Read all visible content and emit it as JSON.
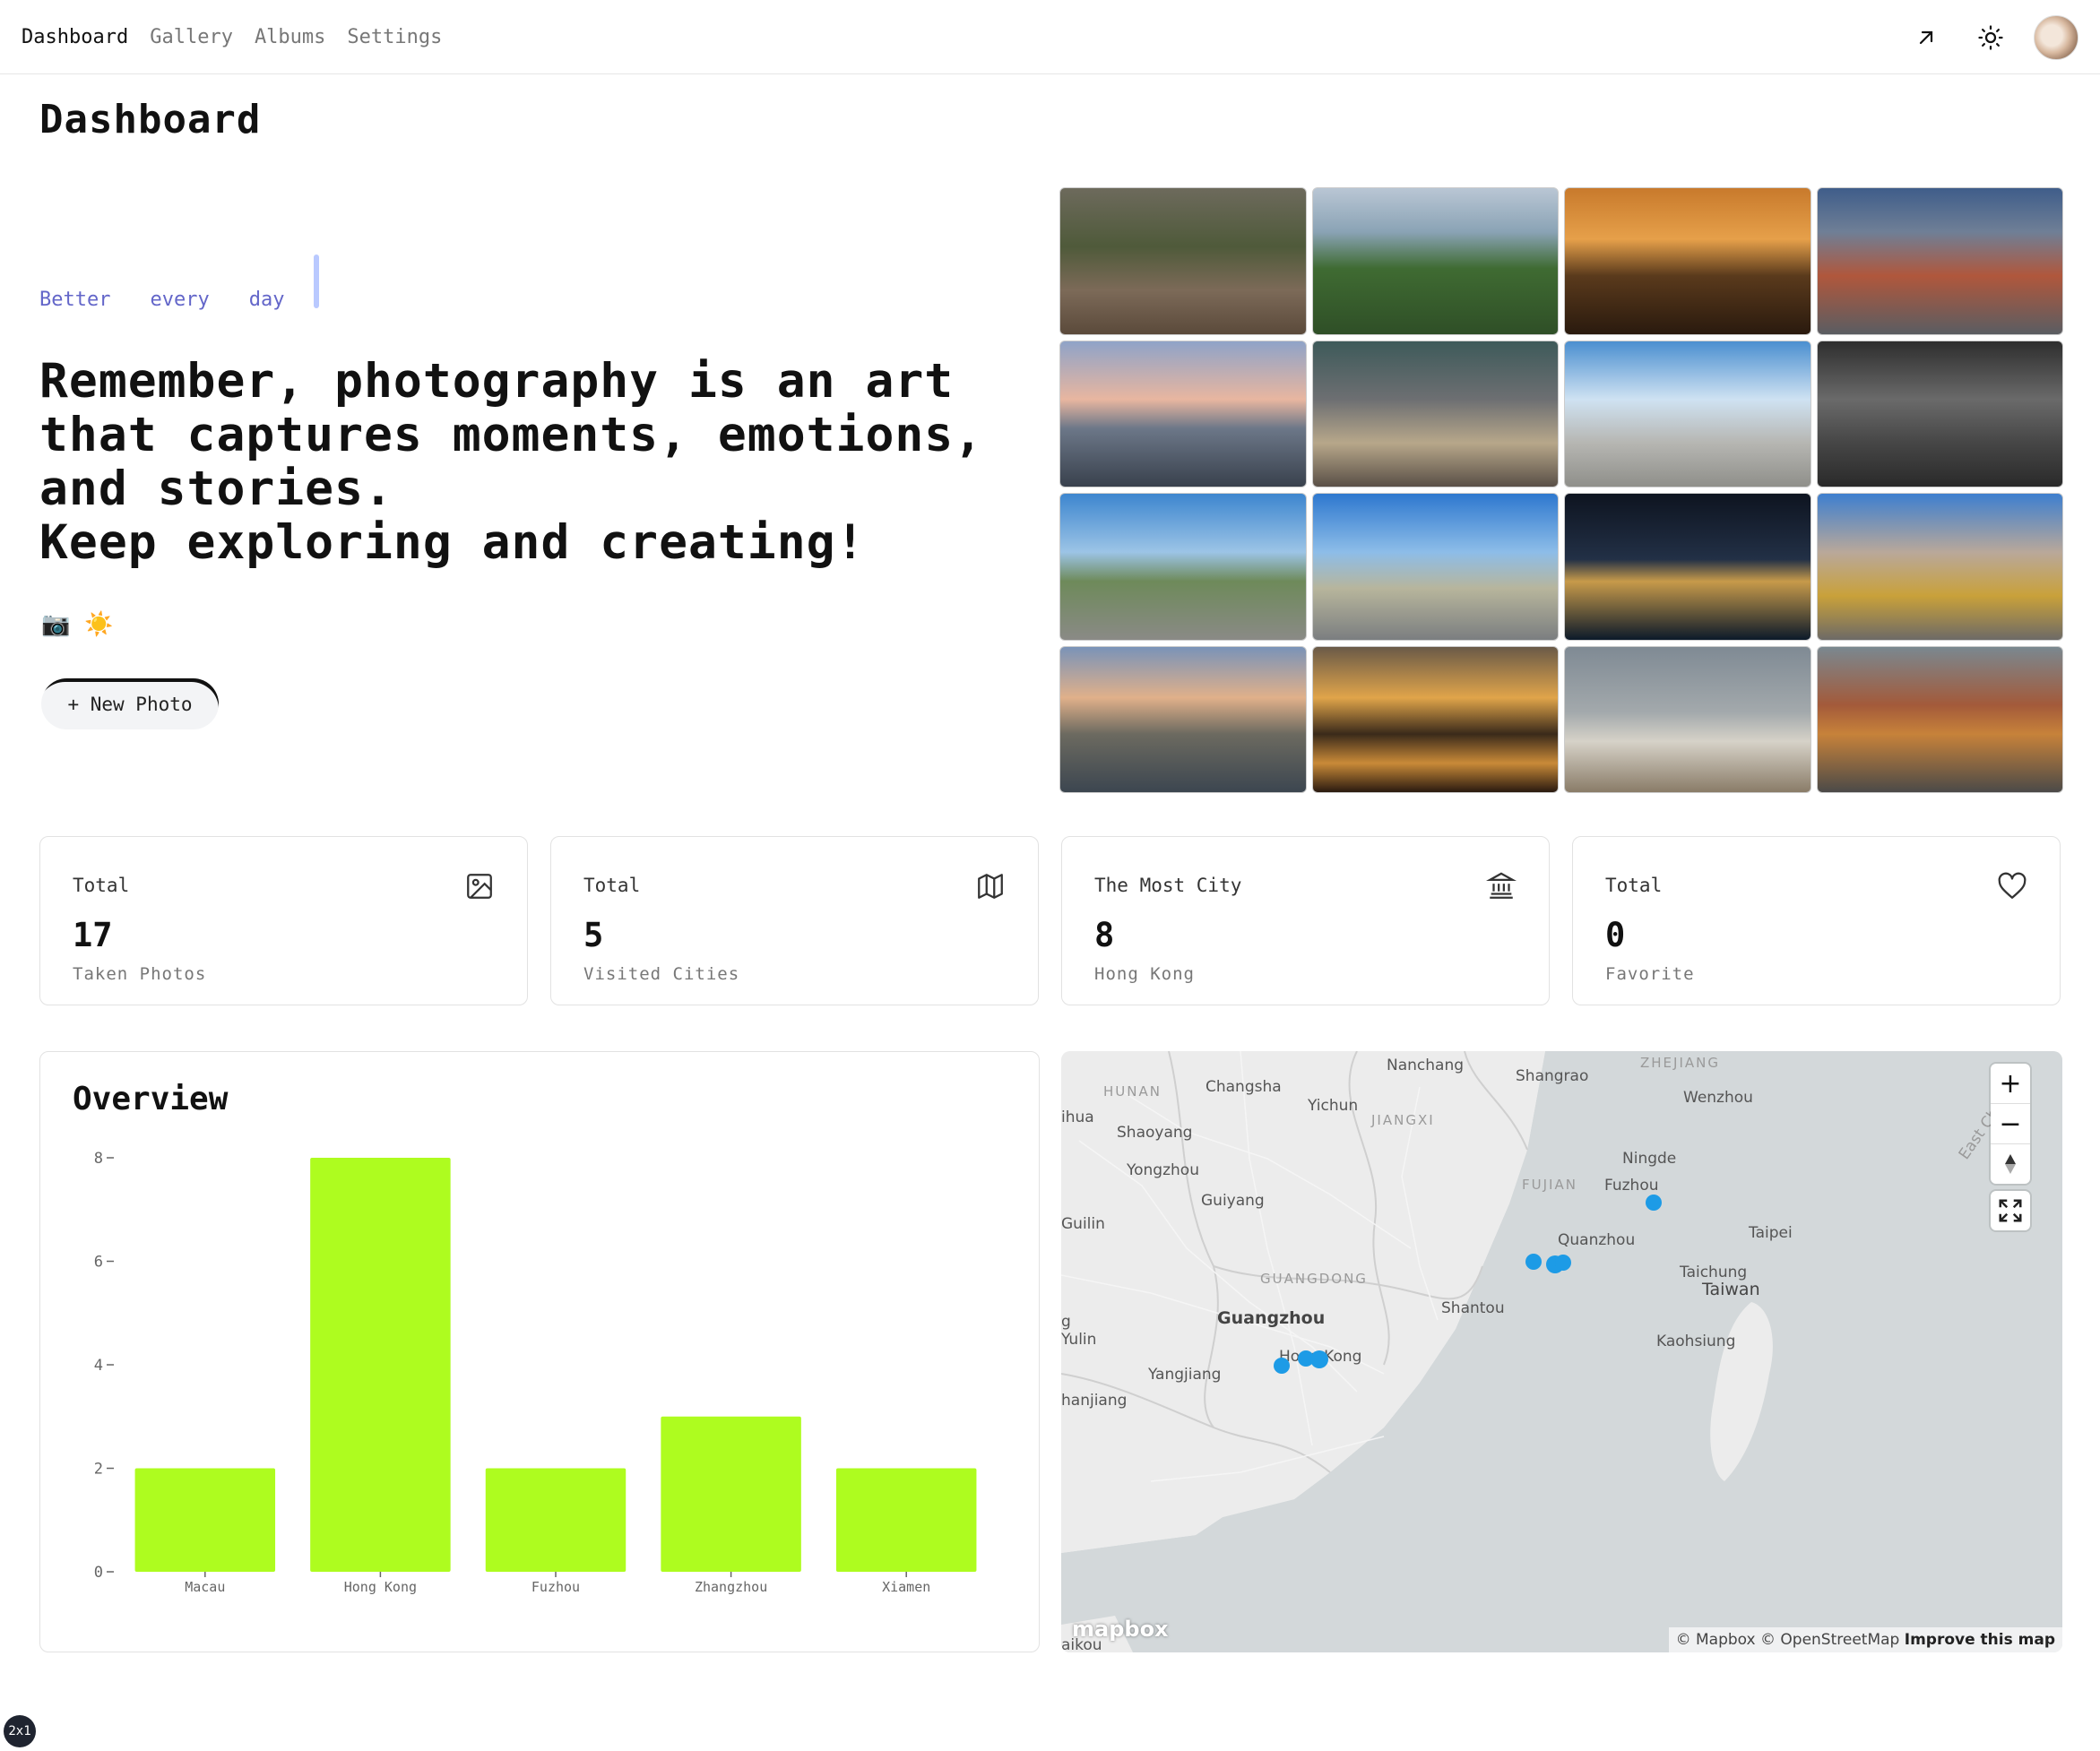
{
  "nav": {
    "links": [
      "Dashboard",
      "Gallery",
      "Albums",
      "Settings"
    ],
    "active": "Dashboard",
    "icons": [
      "external-arrow-icon",
      "sun-icon"
    ]
  },
  "hero": {
    "page_title": "Dashboard",
    "typing_words": [
      "Better",
      "every",
      "day"
    ],
    "quote_lines": [
      "Remember, photography is an art",
      "that captures moments, emotions,",
      "and stories.",
      "Keep exploring and creating!"
    ],
    "emoji": "📷 ☀️",
    "new_photo_label": "+ New Photo"
  },
  "stats": [
    {
      "label": "Total",
      "value": "17",
      "sub": "Taken Photos",
      "icon": "image-icon"
    },
    {
      "label": "Total",
      "value": "5",
      "sub": "Visited Cities",
      "icon": "map-icon"
    },
    {
      "label": "The Most City",
      "value": "8",
      "sub": "Hong Kong",
      "icon": "landmark-icon"
    },
    {
      "label": "Total",
      "value": "0",
      "sub": "Favorite",
      "icon": "heart-icon"
    }
  ],
  "overview": {
    "title": "Overview"
  },
  "chart_data": {
    "type": "bar",
    "categories": [
      "Macau",
      "Hong Kong",
      "Fuzhou",
      "Zhangzhou",
      "Xiamen"
    ],
    "values": [
      2,
      8,
      2,
      3,
      2
    ],
    "ylim": [
      0,
      8
    ],
    "yticks": [
      0,
      2,
      4,
      6,
      8
    ],
    "bar_color": "#aefc1f",
    "grid": false
  },
  "map": {
    "labels": {
      "nanchang": "Nanchang",
      "shangrao": "Shangrao",
      "zhejiang": "ZHEJIANG",
      "hunan": "HUNAN",
      "changsha": "Changsha",
      "yichun": "Yichun",
      "jiangxi": "JIANGXI",
      "wenzhou": "Wenzhou",
      "east_china_sea": "East Chi",
      "ihua": "ihua",
      "shaoyang": "Shaoyang",
      "ningde": "Ningde",
      "yongzhou": "Yongzhou",
      "fujian": "FUJIAN",
      "fuzhou": "Fuzhou",
      "guiyang": "Guiyang",
      "guilin": "Guilin",
      "taipei": "Taipei",
      "quanzhou": "Quanzhou",
      "guangdong": "GUANGDONG",
      "taichung": "Taichung",
      "taiwan": "Taiwan",
      "shantou": "Shantou",
      "guangzhou": "Guangzhou",
      "g": "g",
      "yulin": "Yulin",
      "kaohsiung": "Kaohsiung",
      "hong_kong": "Hong Kong",
      "yangjiang": "Yangjiang",
      "zhanjiang": "hanjiang",
      "haikou": "aikou"
    },
    "zoom_in": "+",
    "zoom_out": "−",
    "logo": "mapbox",
    "attribution": "© Mapbox © OpenStreetMap",
    "improve": "Improve this map",
    "marker_color": "#1d9be6"
  },
  "badge": "2x1"
}
